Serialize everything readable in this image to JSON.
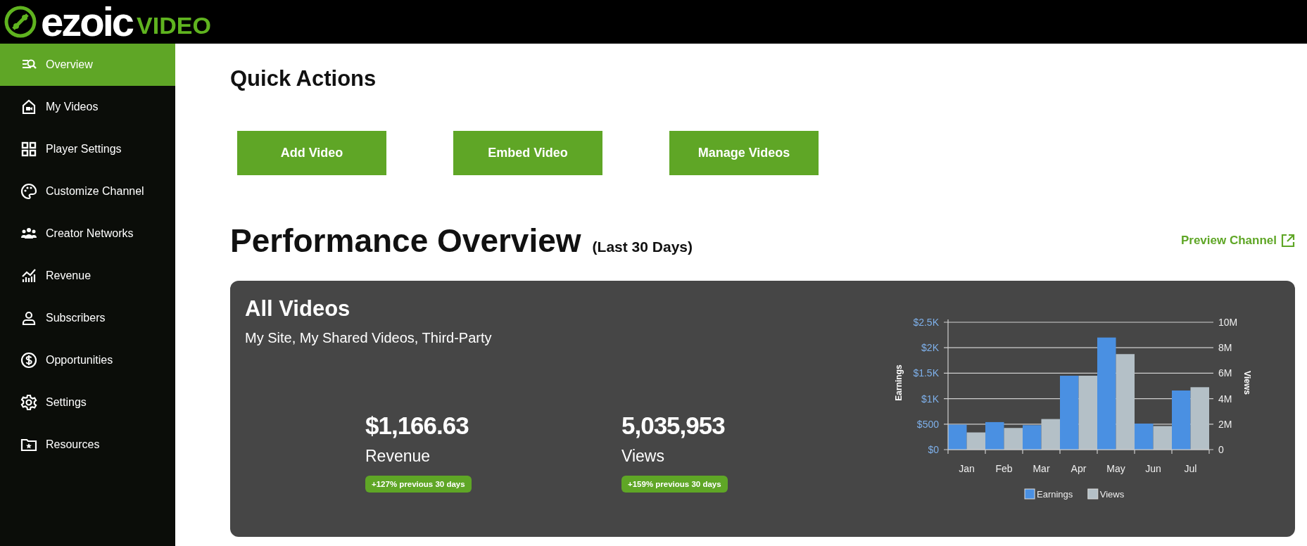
{
  "header": {
    "logo_text": "ezoic",
    "logo_suffix": "VIDEO"
  },
  "sidebar": {
    "items": [
      {
        "label": "Overview",
        "selected": true
      },
      {
        "label": "My Videos",
        "selected": false
      },
      {
        "label": "Player Settings",
        "selected": false
      },
      {
        "label": "Customize Channel",
        "selected": false
      },
      {
        "label": "Creator Networks",
        "selected": false
      },
      {
        "label": "Revenue",
        "selected": false
      },
      {
        "label": "Subscribers",
        "selected": false
      },
      {
        "label": "Opportunities",
        "selected": false
      },
      {
        "label": "Settings",
        "selected": false
      },
      {
        "label": "Resources",
        "selected": false
      }
    ]
  },
  "quick_actions": {
    "title": "Quick Actions",
    "buttons": [
      "Add Video",
      "Embed Video",
      "Manage Videos"
    ]
  },
  "performance": {
    "title": "Performance Overview",
    "period": "(Last 30 Days)",
    "preview_link": "Preview Channel",
    "card": {
      "title": "All Videos",
      "subtitle": "My Site, My Shared Videos, Third-Party",
      "stats": [
        {
          "value": "$1,166.63",
          "label": "Revenue",
          "change": "+127% previous 30 days"
        },
        {
          "value": "5,035,953",
          "label": "Views",
          "change": "+159% previous 30 days"
        }
      ],
      "chart_data": {
        "type": "bar",
        "ylabel": "Earnings",
        "y2label": "Views",
        "categories": [
          "Jan",
          "Feb",
          "Mar",
          "Apr",
          "May",
          "Jun",
          "Jul"
        ],
        "grid": "y",
        "legend": "bottom",
        "ylim": [
          0,
          2500
        ],
        "y2lim": [
          0,
          10000000
        ],
        "yticks": [
          {
            "value": 0,
            "label": "$0"
          },
          {
            "value": 500,
            "label": "$500"
          },
          {
            "value": 1000,
            "label": "$1K"
          },
          {
            "value": 1500,
            "label": "$1.5K"
          },
          {
            "value": 2000,
            "label": "$2K"
          },
          {
            "value": 2500,
            "label": "$2.5K"
          }
        ],
        "y2ticks": [
          {
            "value": 0,
            "label": "0"
          },
          {
            "value": 2000000,
            "label": "2M"
          },
          {
            "value": 4000000,
            "label": "4M"
          },
          {
            "value": 6000000,
            "label": "6M"
          },
          {
            "value": 8000000,
            "label": "8M"
          },
          {
            "value": 10000000,
            "label": "10M"
          }
        ],
        "series": [
          {
            "name": "Earnings",
            "color": "#4a90e2",
            "values": [
              490,
              540,
              480,
              1450,
              2200,
              510,
              1160
            ]
          },
          {
            "name": "Views",
            "color": "#b4c0c7",
            "axis": "y2",
            "values": [
              1350000,
              1700000,
              2400000,
              5800000,
              7500000,
              1850000,
              4900000
            ]
          }
        ]
      }
    }
  }
}
